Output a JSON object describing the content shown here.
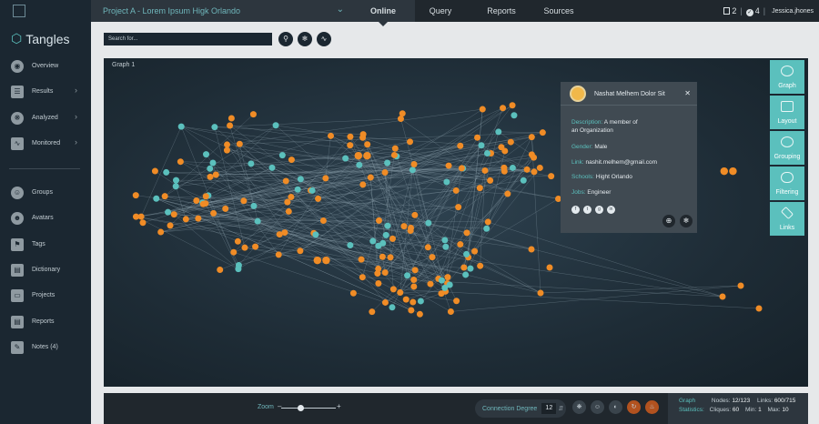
{
  "sidebar": {
    "brand": "Tangles",
    "items": [
      {
        "label": "Overview",
        "icon": "eye-icon",
        "chevron": false
      },
      {
        "label": "Results",
        "icon": "results-icon",
        "chevron": true
      },
      {
        "label": "Analyzed",
        "icon": "analyzed-icon",
        "chevron": true
      },
      {
        "label": "Monitored",
        "icon": "monitored-icon",
        "chevron": true
      },
      {
        "label": "Groups",
        "icon": "groups-icon",
        "chevron": false
      },
      {
        "label": "Avatars",
        "icon": "avatar-icon",
        "chevron": false
      },
      {
        "label": "Tags",
        "icon": "tag-icon",
        "chevron": false
      },
      {
        "label": "Dictionary",
        "icon": "dictionary-icon",
        "chevron": false
      },
      {
        "label": "Projects",
        "icon": "folder-icon",
        "chevron": false
      },
      {
        "label": "Reports",
        "icon": "reports-icon",
        "chevron": false
      },
      {
        "label": "Notes (4)",
        "icon": "notes-icon",
        "chevron": false
      }
    ]
  },
  "topbar": {
    "project": "Project A - Lorem Ipsum Higk Orlando",
    "tabs": [
      "Online",
      "Query",
      "Reports",
      "Sources"
    ],
    "active_tab": "Online",
    "docs_count": "2",
    "checks_count": "4",
    "user": "Jessica.jhones"
  },
  "search": {
    "placeholder": "Search for..."
  },
  "graph": {
    "label": "Graph 1"
  },
  "tools": [
    "Graph",
    "Layout",
    "Grouping",
    "Filtering",
    "Links"
  ],
  "popup": {
    "name": "Nashat Melhem Dolor Sit",
    "description_key": "Description:",
    "description_val": "A member of",
    "description_val2": "an Organization",
    "gender_key": "Gender:",
    "gender_val": "Male",
    "link_key": "Link:",
    "link_val": "nashit.melhem@gmail.com",
    "schools_key": "Schools:",
    "schools_val": "Hight Orlando",
    "jobs_key": "Jobs:",
    "jobs_val": "Engineer",
    "socials": [
      "f",
      "t",
      "g",
      "in"
    ]
  },
  "bottom": {
    "zoom_label": "Zoom",
    "zoom_level": 0.35,
    "connection_label": "Connection Degree",
    "connection_value": "12"
  },
  "stats": {
    "graph_label": "Graph",
    "statistics_label": "Statistics:",
    "nodes_label": "Nodes:",
    "nodes_value": "12/123",
    "links_label": "Links:",
    "links_value": "600/715",
    "cliques_label": "Cliques:",
    "cliques_value": "60",
    "min_label": "Min:",
    "min_value": "1",
    "max_label": "Max:",
    "max_value": "10"
  },
  "colors": {
    "accent": "#5bc0bd",
    "orange_node": "#f08c26",
    "teal_node": "#5bc0bd",
    "sidebar_bg": "#1b2731"
  }
}
